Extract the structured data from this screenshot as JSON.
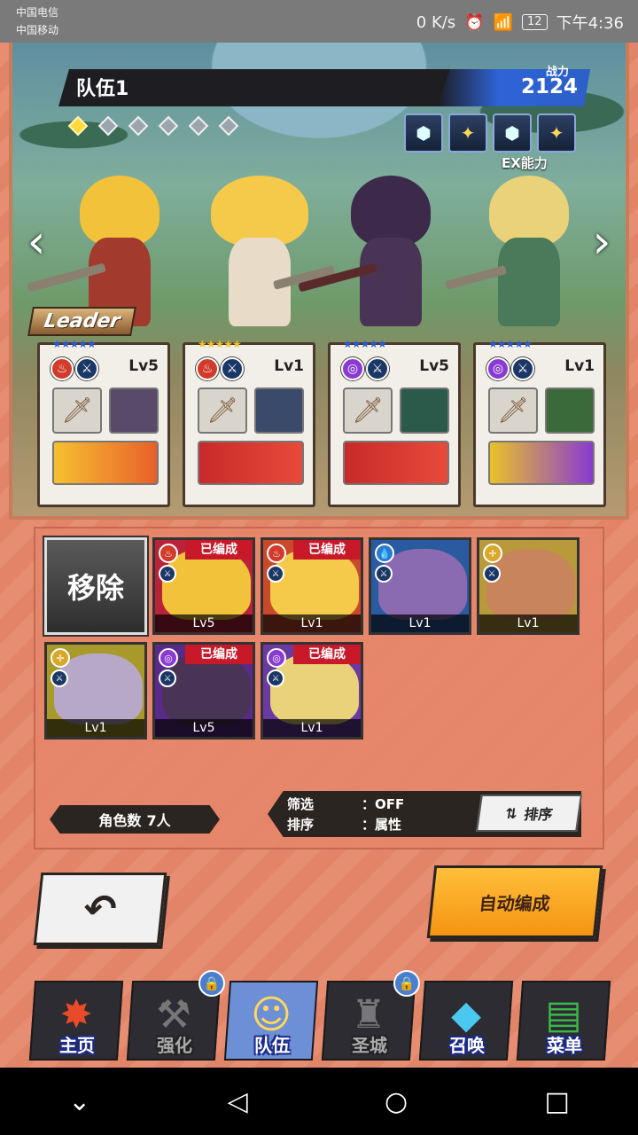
{
  "status": {
    "carrier1": "中国电信",
    "carrier2": "中国移动",
    "net_speed": "0 K/s",
    "battery": "12",
    "time": "下午4:36"
  },
  "team": {
    "name": "队伍1",
    "power_label": "战力",
    "power_value": "2124",
    "ex_label": "EX能力",
    "leader_label": "Leader",
    "page_dots": 6,
    "active_dot": 0
  },
  "party": [
    {
      "level": "Lv5",
      "stars": "★★★★★",
      "element_color": "#d23a2a",
      "element_icon": "fire-icon"
    },
    {
      "level": "Lv1",
      "stars": "★★★★★",
      "element_color": "#d23a2a",
      "element_icon": "fire-icon"
    },
    {
      "level": "Lv5",
      "stars": "★★★★★",
      "element_color": "#8a3ad2",
      "element_icon": "shadow-icon"
    },
    {
      "level": "Lv1",
      "stars": "★★★★★",
      "element_color": "#8a3ad2",
      "element_icon": "shadow-icon"
    }
  ],
  "roster": {
    "remove_label": "移除",
    "units": [
      {
        "level": "Lv5",
        "badge": "已编成",
        "element_color": "#d23a2a",
        "bg": "#b8233a"
      },
      {
        "level": "Lv1",
        "badge": "已编成",
        "element_color": "#d23a2a",
        "bg": "#c84a2a"
      },
      {
        "level": "Lv1",
        "badge": "",
        "element_color": "#2a7ad2",
        "bg": "#2a5aa0"
      },
      {
        "level": "Lv1",
        "badge": "",
        "element_color": "#d8a82a",
        "bg": "#b89a3a"
      },
      {
        "level": "Lv1",
        "badge": "",
        "element_color": "#d8a82a",
        "bg": "#a89a2a"
      },
      {
        "level": "Lv5",
        "badge": "已编成",
        "element_color": "#8a3ad2",
        "bg": "#5a2a8a"
      },
      {
        "level": "Lv1",
        "badge": "已编成",
        "element_color": "#8a3ad2",
        "bg": "#6a3aa0"
      }
    ],
    "count_label": "角色数",
    "count_value": "7人",
    "filter_label": "筛选",
    "filter_value": "：OFF",
    "sort_label": "排序",
    "sort_value": "：属性",
    "sort_button": "排序"
  },
  "actions": {
    "back_icon": "back-arrow-icon",
    "auto_label": "自动编成"
  },
  "nav": [
    {
      "label": "主页",
      "icon": "home-icon",
      "locked": false,
      "active": false
    },
    {
      "label": "强化",
      "icon": "hammer-icon",
      "locked": true,
      "active": false
    },
    {
      "label": "队伍",
      "icon": "party-icon",
      "locked": false,
      "active": true
    },
    {
      "label": "圣城",
      "icon": "castle-icon",
      "locked": true,
      "active": false
    },
    {
      "label": "召唤",
      "icon": "crystal-icon",
      "locked": false,
      "active": false
    },
    {
      "label": "菜单",
      "icon": "book-icon",
      "locked": false,
      "active": false
    }
  ]
}
